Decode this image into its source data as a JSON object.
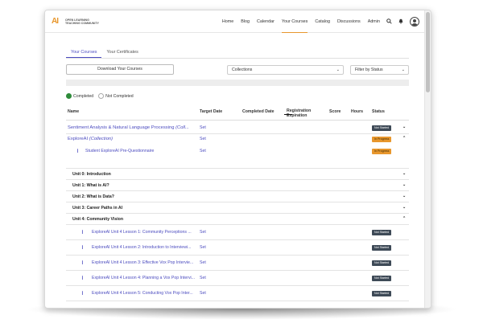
{
  "logo": {
    "mark": "AI",
    "text_line1": "OPEN LEARNING",
    "text_line2": "TEACHING COMMUNITY"
  },
  "nav": {
    "items": [
      {
        "label": "Home",
        "active": false
      },
      {
        "label": "Blog",
        "active": false
      },
      {
        "label": "Calendar",
        "active": false
      },
      {
        "label": "Your Courses",
        "active": true
      },
      {
        "label": "Catalog",
        "active": false
      },
      {
        "label": "Discussions",
        "active": false
      },
      {
        "label": "Admin",
        "active": false
      }
    ],
    "search_icon": "⌕",
    "bell_icon": "🔔"
  },
  "tabs": [
    {
      "label": "Your Courses",
      "active": true
    },
    {
      "label": "Your Certificates",
      "active": false
    }
  ],
  "controls": {
    "download_label": "Download Your Courses",
    "collections_value": "Collections",
    "status_filter_value": "Filter by Status"
  },
  "legend": {
    "completed": "Completed",
    "not_completed": "Not Completed"
  },
  "table": {
    "headers": {
      "name": "Name",
      "target_date": "Target Date",
      "completed_date": "Completed Date",
      "registration_line1": "Registration",
      "registration_line2": "Expiration",
      "score": "Score",
      "hours": "Hours",
      "status": "Status"
    },
    "rows": [
      {
        "name": "Sentiment Analysis & Natural Language Processing",
        "suffix": "(Coll...",
        "set": "Set",
        "status": "Not Started"
      },
      {
        "name": "ExploreAI",
        "suffix": "(Collection)",
        "set": "Set",
        "status": "In Progress"
      },
      {
        "name": "Student ExploreAI Pre-Questionnaire",
        "set": "Set",
        "status": "In Progress"
      },
      {
        "name": "Unit 0: Introduction"
      },
      {
        "name": "Unit 1: What is AI?"
      },
      {
        "name": "Unit 2: What is Data?"
      },
      {
        "name": "Unit 3: Career Paths in AI"
      },
      {
        "name": "Unit 4: Community Vision"
      },
      {
        "name": "ExploreAI Unit 4 Lesson 1: Community Perceptions ...",
        "set": "Set",
        "status": "Not Started"
      },
      {
        "name": "ExploreAI Unit 4 Lesson 2: Introduction to Interviewi...",
        "set": "Set",
        "status": "Not Started"
      },
      {
        "name": "ExploreAI Unit 4 Lesson 3: Effective Vox Pop Intervie...",
        "set": "Set",
        "status": "Not Started"
      },
      {
        "name": "ExploreAI Unit 4 Lesson 4: Planning a Vox Pop Intervi...",
        "set": "Set",
        "status": "Not Started"
      },
      {
        "name": "ExploreAI Unit 4 Lesson 5: Conducting Vox Pop Inter...",
        "set": "Set",
        "status": "Not Started"
      }
    ]
  },
  "colors": {
    "accent": "#e8972d",
    "link": "#4b4bbf",
    "not_started": "#3e4a57",
    "completed": "#2e8b3a"
  }
}
